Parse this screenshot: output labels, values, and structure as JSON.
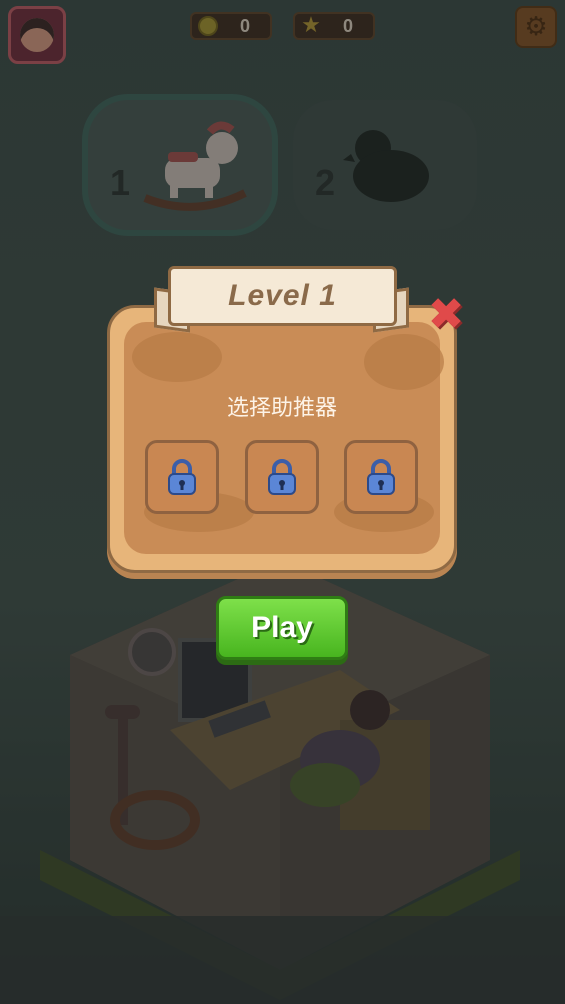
{
  "topbar": {
    "coins_value": "0",
    "stars_value": "0"
  },
  "levels": [
    {
      "number": "1",
      "state": "unlocked",
      "icon": "rocking-horse-icon"
    },
    {
      "number": "2",
      "state": "locked",
      "icon": "duck-silhouette-icon"
    }
  ],
  "modal": {
    "title": "Level 1",
    "caption": "选择助推器",
    "booster_slots": [
      {
        "state": "locked",
        "icon": "lock-icon"
      },
      {
        "state": "locked",
        "icon": "lock-icon"
      },
      {
        "state": "locked",
        "icon": "lock-icon"
      }
    ]
  },
  "play_button": {
    "label": "Play"
  },
  "colors": {
    "modal_bg": "#e7b57a",
    "play_green": "#5ccc2d",
    "close_red": "#e04a4a"
  }
}
